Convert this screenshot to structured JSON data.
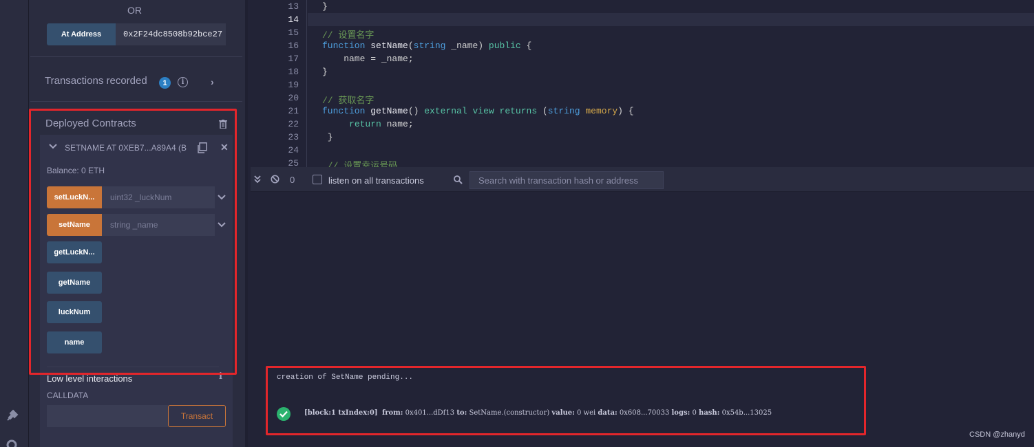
{
  "panel": {
    "or_label": "OR",
    "at_address_label": "At Address",
    "at_address_value": "0x2F24dc8508b92bce27",
    "transactions_recorded_label": "Transactions recorded",
    "transactions_recorded_count": "1"
  },
  "deployed": {
    "title": "Deployed Contracts",
    "contract_name": "SETNAME AT 0XEB7...A89A4 (B",
    "balance": "Balance: 0 ETH",
    "functions": [
      {
        "label": "setLuckN...",
        "type": "transact",
        "arg_placeholder": "uint32 _luckNum"
      },
      {
        "label": "setName",
        "type": "transact",
        "arg_placeholder": "string _name"
      },
      {
        "label": "getLuckN...",
        "type": "call"
      },
      {
        "label": "getName",
        "type": "call"
      },
      {
        "label": "luckNum",
        "type": "call"
      },
      {
        "label": "name",
        "type": "call"
      }
    ],
    "low_level_title": "Low level interactions",
    "calldata_label": "CALLDATA",
    "transact_label": "Transact"
  },
  "editor": {
    "current_line": 14,
    "lines": [
      {
        "n": "13",
        "text": "}"
      },
      {
        "n": "14",
        "text": ""
      },
      {
        "n": "15",
        "text": "// 设置名字"
      },
      {
        "n": "16",
        "text": "function setName(string _name) public {"
      },
      {
        "n": "17",
        "text": "    name = _name;"
      },
      {
        "n": "18",
        "text": "}"
      },
      {
        "n": "19",
        "text": ""
      },
      {
        "n": "20",
        "text": "// 获取名字"
      },
      {
        "n": "21",
        "text": "function getName() external view returns (string memory) {"
      },
      {
        "n": "22",
        "text": "     return name;"
      },
      {
        "n": "23",
        "text": " }"
      },
      {
        "n": "24",
        "text": ""
      },
      {
        "n": "25",
        "text": " // 设置幸运号码"
      }
    ]
  },
  "terminal": {
    "count": "0",
    "listen_label": "listen on all transactions",
    "search_placeholder": "Search with transaction hash or address",
    "pending_msg": "creation of SetName pending...",
    "tx": {
      "block": "[block:1 txIndex:0]",
      "from_label": "from:",
      "from": "0x401...dDf13",
      "to_label": "to:",
      "to": "SetName.(constructor)",
      "value_label": "value:",
      "value": "0 wei",
      "data_label": "data:",
      "data": "0x608...70033",
      "logs_label": "logs:",
      "logs": "0",
      "hash_label": "hash:",
      "hash": "0x54b...13025"
    }
  },
  "watermark": "CSDN @zhanyd",
  "colors": {
    "accent_orange": "#c97539",
    "button_blue": "#35506e",
    "highlight_red": "#e3262b",
    "success_green": "#2bb26e"
  }
}
